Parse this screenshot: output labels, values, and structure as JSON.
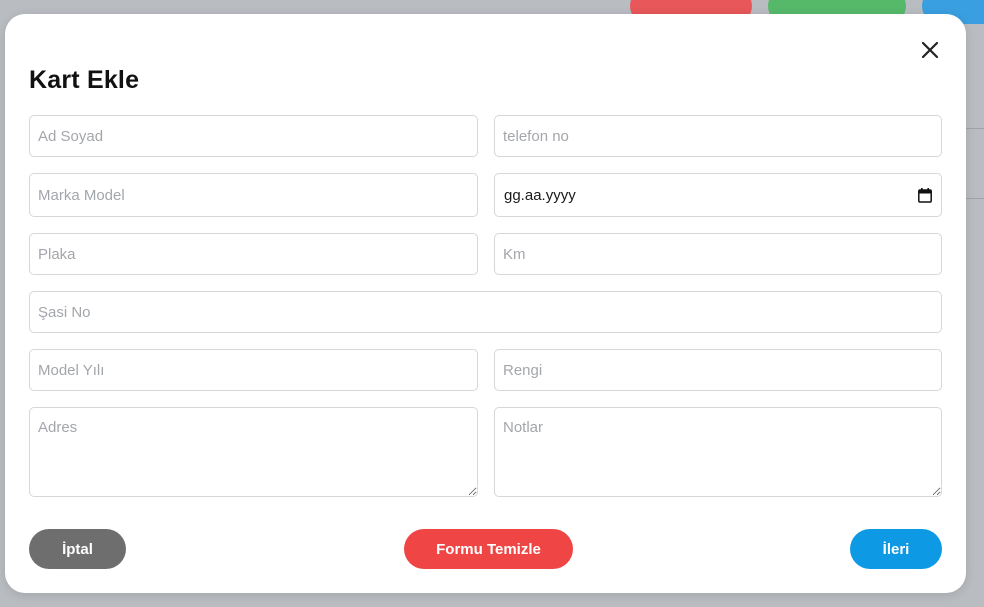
{
  "modal": {
    "title": "Kart Ekle",
    "close_icon": "close-icon"
  },
  "form": {
    "ad_soyad_placeholder": "Ad Soyad",
    "telefon_placeholder": "telefon no",
    "marka_model_placeholder": "Marka Model",
    "date_value": "gg.aa.yyyy",
    "date_icon": "calendar-icon",
    "plaka_placeholder": "Plaka",
    "km_placeholder": "Km",
    "sasi_no_placeholder": "Şasi No",
    "model_yili_placeholder": "Model Yılı",
    "rengi_placeholder": "Rengi",
    "adres_placeholder": "Adres",
    "notlar_placeholder": "Notlar"
  },
  "buttons": {
    "cancel_label": "İptal",
    "clear_label": "Formu Temizle",
    "next_label": "İleri"
  },
  "colors": {
    "cancel": "#6e6e6e",
    "clear": "#ef4545",
    "next": "#0d99e3"
  }
}
